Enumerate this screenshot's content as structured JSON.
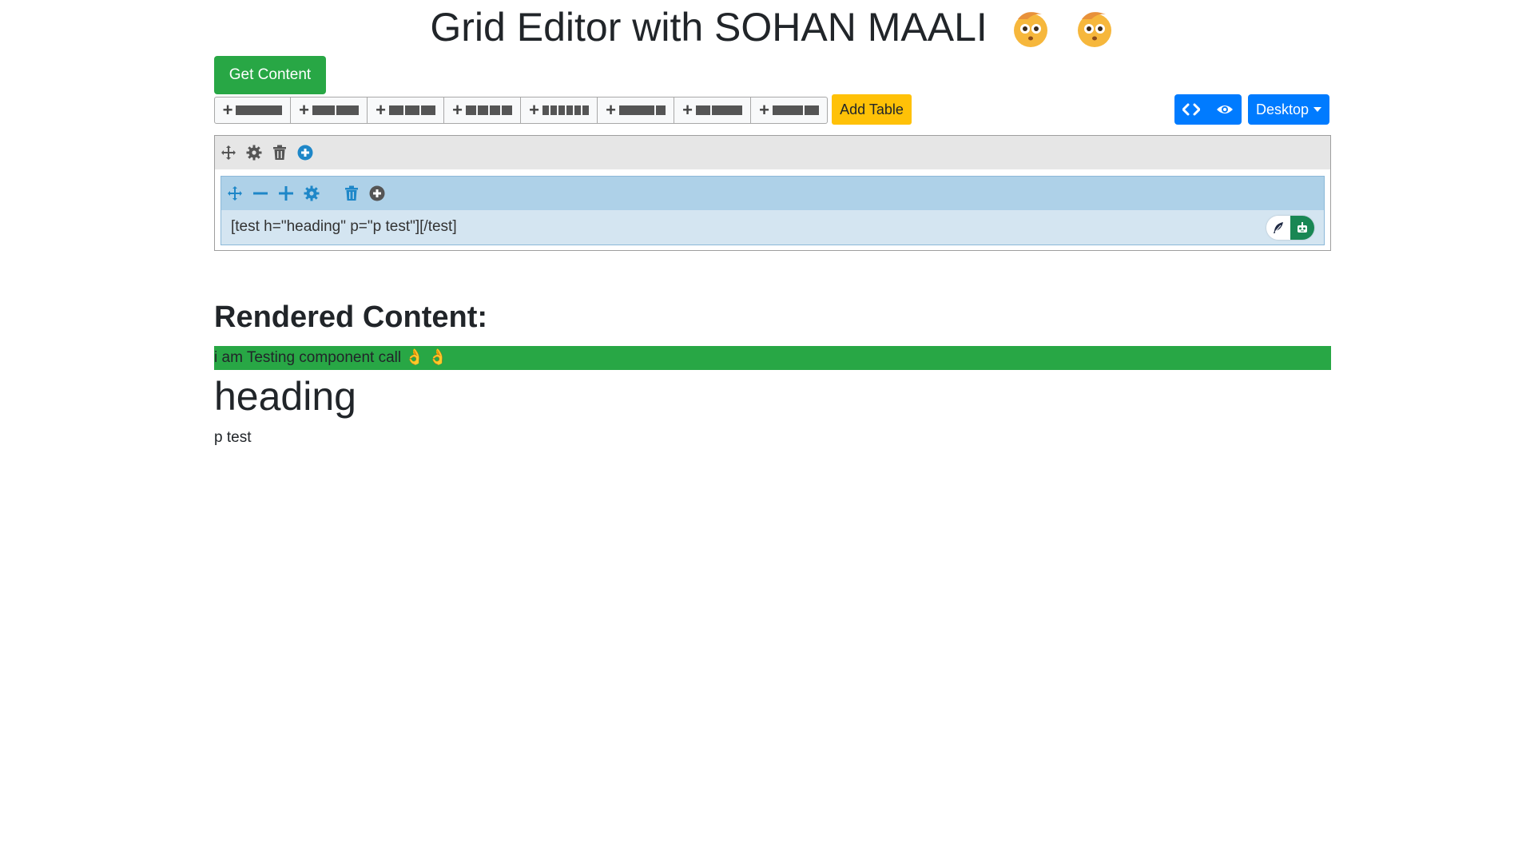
{
  "header": {
    "title": "Grid Editor with SOHAN MAALI",
    "emojis": [
      "face-emoji",
      "face-emoji"
    ]
  },
  "actions": {
    "get_content_label": "Get Content",
    "add_table_label": "Add Table",
    "device_label": "Desktop"
  },
  "grid_buttons": [
    {
      "name": "grid-layout-1",
      "icon": "plus-icon"
    },
    {
      "name": "grid-layout-2",
      "icon": "plus-icon"
    },
    {
      "name": "grid-layout-3",
      "icon": "plus-icon"
    },
    {
      "name": "grid-layout-4",
      "icon": "plus-icon"
    },
    {
      "name": "grid-layout-5",
      "icon": "plus-icon"
    },
    {
      "name": "grid-layout-6",
      "icon": "plus-icon"
    },
    {
      "name": "grid-layout-7",
      "icon": "plus-icon"
    },
    {
      "name": "grid-layout-8",
      "icon": "plus-icon"
    }
  ],
  "editor": {
    "column_content": "[test h=\"heading\" p=\"p test\"][/test]"
  },
  "rendered": {
    "heading": "Rendered Content:",
    "banner_text": "i am Testing component call 👌 👌",
    "component_heading": "heading",
    "component_paragraph": "p test"
  },
  "colors": {
    "primary": "#007bff",
    "success": "#28a745",
    "warning": "#ffc107",
    "row_toolbar": "#e6e6e6",
    "column_toolbar": "#aed1e8",
    "column_body": "#d4e5f1"
  }
}
